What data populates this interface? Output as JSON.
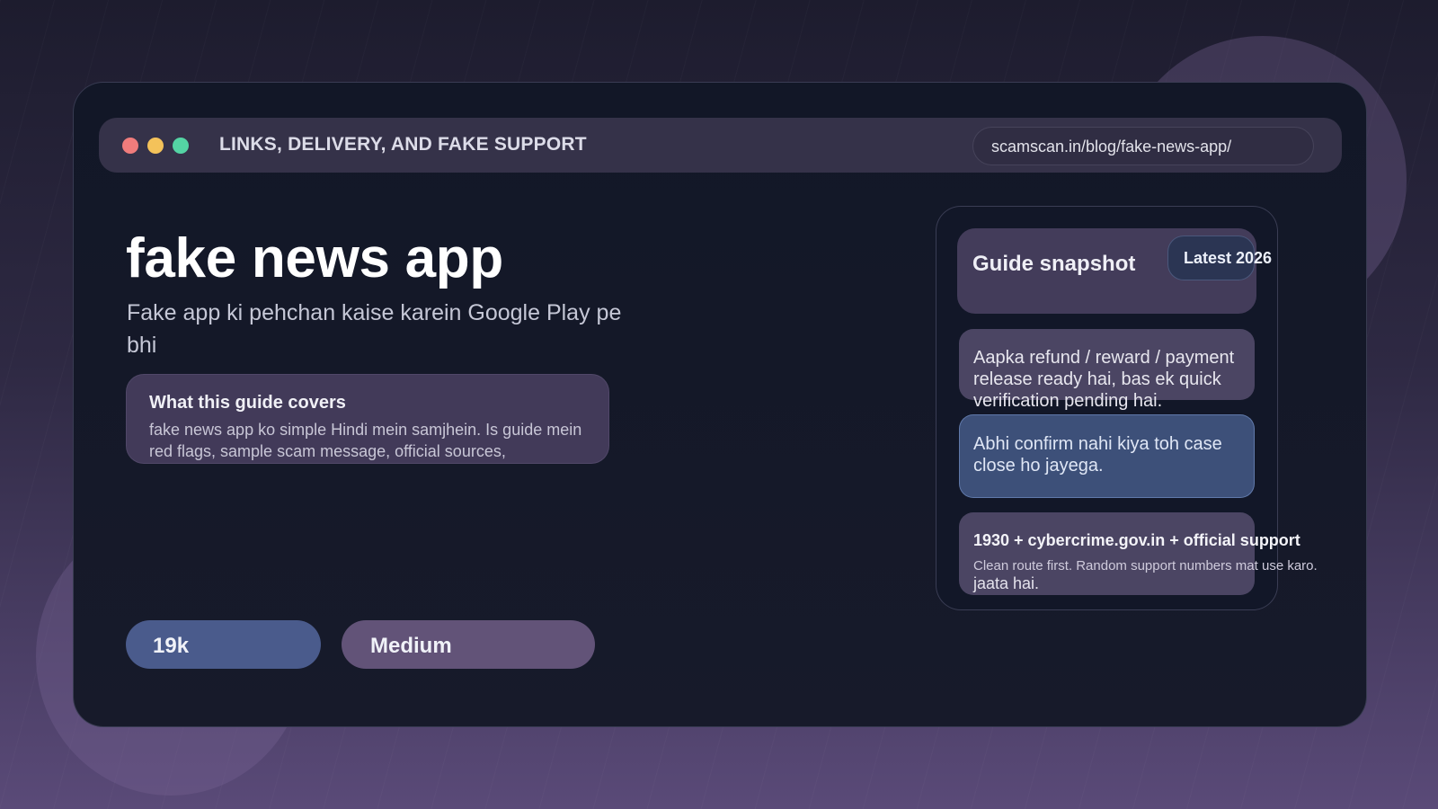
{
  "titlebar": {
    "title": "LINKS, DELIVERY, AND FAKE SUPPORT",
    "url": "scamscan.in/blog/fake-news-app/"
  },
  "hero": {
    "title": "fake news app",
    "subtitle": "Fake app ki pehchan kaise karein Google Play pe bhi"
  },
  "covers": {
    "heading": "What this guide covers",
    "text": "fake news app ko simple Hindi mein samjhein. Is guide mein red flags, sample scam message, official sources,"
  },
  "stats": {
    "views": "19k",
    "level": "Medium"
  },
  "snapshot": {
    "title": "Guide snapshot",
    "badge": "Latest 2026",
    "message": "Aapka refund / reward / payment release ready hai, bas ek quick verification pending hai.",
    "warning": "Abhi confirm nahi kiya toh case close ho jayega.",
    "support_title": "1930 + cybercrime.gov.in + official support",
    "support_text": "Clean route first. Random support numbers mat use karo.",
    "support_extra": "jaata hai."
  },
  "colors": {
    "dot_red": "#f07c7c",
    "dot_yellow": "#f4c25a",
    "dot_green": "#54d4a4",
    "views_pill": "#4a5b8c",
    "level_pill": "#625378"
  }
}
